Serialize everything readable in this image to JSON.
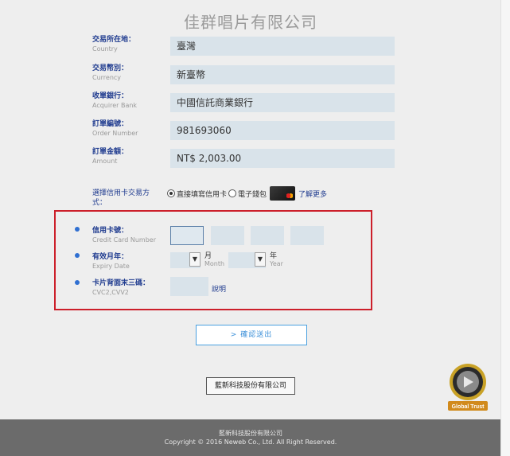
{
  "header": {
    "merchant_name": "佳群唱片有限公司"
  },
  "fields": [
    {
      "label": "交易所在地：",
      "label_en": "Country",
      "value": "臺灣"
    },
    {
      "label": "交易幣別：",
      "label_en": "Currency",
      "value": "新臺幣"
    },
    {
      "label": "收單銀行：",
      "label_en": "Acquirer Bank",
      "value": "中國信託商業銀行"
    },
    {
      "label": "訂單編號：",
      "label_en": "Order Number",
      "value": "981693060"
    },
    {
      "label": "訂單金額：",
      "label_en": "Amount",
      "value": "NT$ 2,003.00"
    }
  ],
  "payment_method": {
    "label": "選擇信用卡交易方式：",
    "option_direct": "直接填寫信用卡",
    "option_wallet": "電子錢包",
    "selected": "direct",
    "learn_more": "了解更多",
    "card_icon": "mastercard-icon"
  },
  "card_form": {
    "card_number_label": "信用卡號：",
    "card_number_label_en": "Credit Card Number",
    "expiry_label": "有效月年：",
    "expiry_label_en": "Expiry Date",
    "month_unit": "月",
    "month_unit_en": "Month",
    "year_unit": "年",
    "year_unit_en": "Year",
    "cvc_label": "卡片背面末三碼：",
    "cvc_label_en": "CVC2,CVV2",
    "explain_link": "說明"
  },
  "actions": {
    "submit_label": "> 確認送出"
  },
  "company_button": "藍新科技股份有限公司",
  "seal": {
    "text": "Global Trust",
    "icon": "trust-seal-icon"
  },
  "footer": {
    "company": "藍新科技股份有限公司",
    "copyright": "Copyright © 2016 Neweb Co., Ltd. All Right Reserved."
  },
  "colors": {
    "accent_blue": "#1f3b8f",
    "highlight_red": "#cc1f2a",
    "field_bg": "#d9e3ea",
    "footer_bg": "#6b6b6b"
  }
}
